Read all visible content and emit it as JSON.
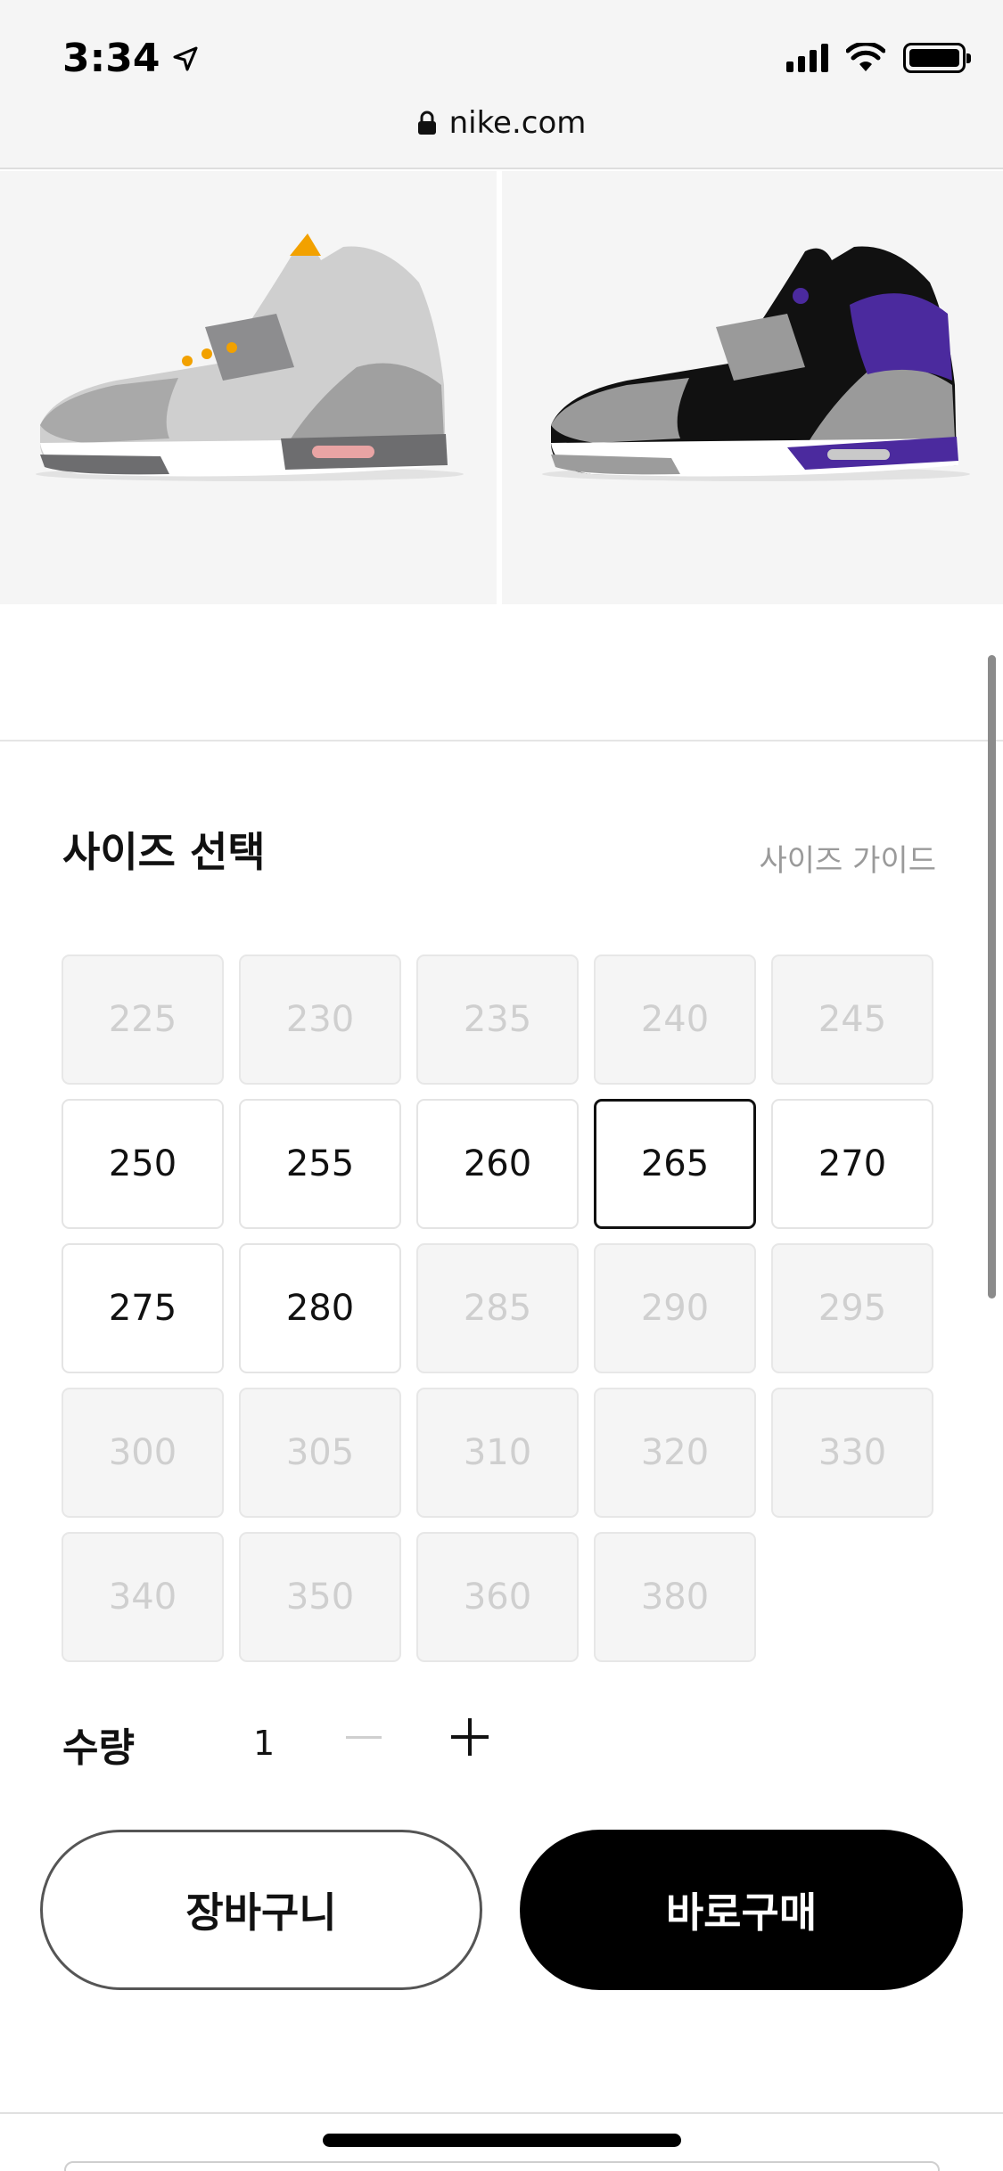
{
  "status_bar": {
    "time": "3:34"
  },
  "browser": {
    "url": "nike.com"
  },
  "size_section": {
    "title": "사이즈 선택",
    "guide_link": "사이즈 가이드",
    "sizes": [
      {
        "label": "225",
        "available": false
      },
      {
        "label": "230",
        "available": false
      },
      {
        "label": "235",
        "available": false
      },
      {
        "label": "240",
        "available": false
      },
      {
        "label": "245",
        "available": false
      },
      {
        "label": "250",
        "available": true
      },
      {
        "label": "255",
        "available": true
      },
      {
        "label": "260",
        "available": true
      },
      {
        "label": "265",
        "available": true,
        "selected": true
      },
      {
        "label": "270",
        "available": true
      },
      {
        "label": "275",
        "available": true
      },
      {
        "label": "280",
        "available": true
      },
      {
        "label": "285",
        "available": false
      },
      {
        "label": "290",
        "available": false
      },
      {
        "label": "295",
        "available": false
      },
      {
        "label": "300",
        "available": false
      },
      {
        "label": "305",
        "available": false
      },
      {
        "label": "310",
        "available": false
      },
      {
        "label": "320",
        "available": false
      },
      {
        "label": "330",
        "available": false
      },
      {
        "label": "340",
        "available": false
      },
      {
        "label": "350",
        "available": false
      },
      {
        "label": "360",
        "available": false
      },
      {
        "label": "380",
        "available": false
      }
    ]
  },
  "quantity": {
    "label": "수량",
    "value": "1"
  },
  "actions": {
    "cart_label": "장바구니",
    "buy_label": "바로구매"
  },
  "colors": {
    "accent_purple": "#4b2a9e",
    "button_black": "#000000"
  }
}
